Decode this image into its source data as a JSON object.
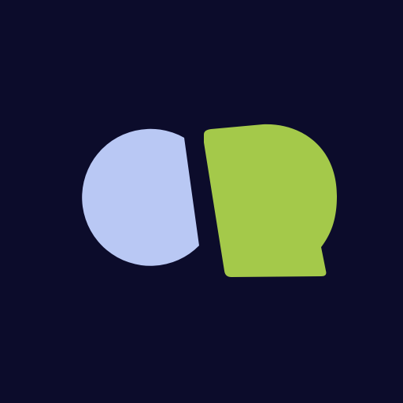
{
  "app_icon": {
    "icon": "logo-icon",
    "colors": {
      "background": "#0c0c2b",
      "left_shape": "#b9c8f4",
      "right_shape": "#a4c94a"
    }
  }
}
